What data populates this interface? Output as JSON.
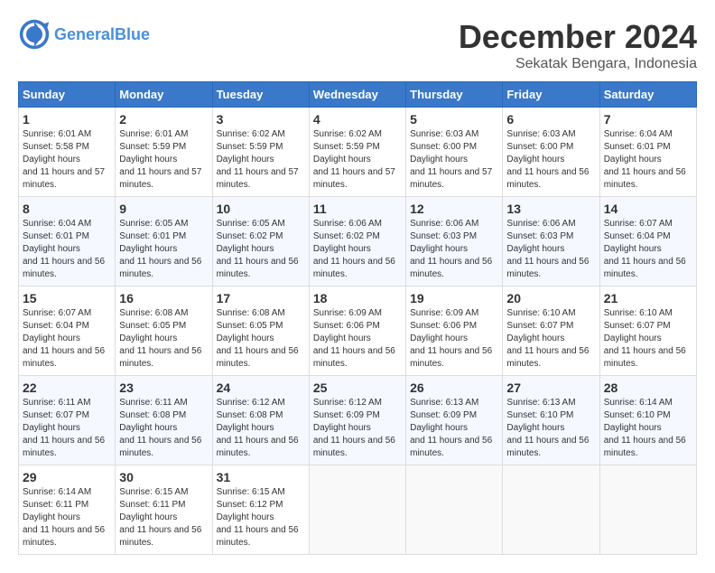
{
  "header": {
    "logo_text_general": "General",
    "logo_text_blue": "Blue",
    "month": "December 2024",
    "location": "Sekatak Bengara, Indonesia"
  },
  "weekdays": [
    "Sunday",
    "Monday",
    "Tuesday",
    "Wednesday",
    "Thursday",
    "Friday",
    "Saturday"
  ],
  "weeks": [
    [
      {
        "day": "1",
        "sunrise": "6:01 AM",
        "sunset": "5:58 PM",
        "daylight": "11 hours and 57 minutes."
      },
      {
        "day": "2",
        "sunrise": "6:01 AM",
        "sunset": "5:59 PM",
        "daylight": "11 hours and 57 minutes."
      },
      {
        "day": "3",
        "sunrise": "6:02 AM",
        "sunset": "5:59 PM",
        "daylight": "11 hours and 57 minutes."
      },
      {
        "day": "4",
        "sunrise": "6:02 AM",
        "sunset": "5:59 PM",
        "daylight": "11 hours and 57 minutes."
      },
      {
        "day": "5",
        "sunrise": "6:03 AM",
        "sunset": "6:00 PM",
        "daylight": "11 hours and 57 minutes."
      },
      {
        "day": "6",
        "sunrise": "6:03 AM",
        "sunset": "6:00 PM",
        "daylight": "11 hours and 56 minutes."
      },
      {
        "day": "7",
        "sunrise": "6:04 AM",
        "sunset": "6:01 PM",
        "daylight": "11 hours and 56 minutes."
      }
    ],
    [
      {
        "day": "8",
        "sunrise": "6:04 AM",
        "sunset": "6:01 PM",
        "daylight": "11 hours and 56 minutes."
      },
      {
        "day": "9",
        "sunrise": "6:05 AM",
        "sunset": "6:01 PM",
        "daylight": "11 hours and 56 minutes."
      },
      {
        "day": "10",
        "sunrise": "6:05 AM",
        "sunset": "6:02 PM",
        "daylight": "11 hours and 56 minutes."
      },
      {
        "day": "11",
        "sunrise": "6:06 AM",
        "sunset": "6:02 PM",
        "daylight": "11 hours and 56 minutes."
      },
      {
        "day": "12",
        "sunrise": "6:06 AM",
        "sunset": "6:03 PM",
        "daylight": "11 hours and 56 minutes."
      },
      {
        "day": "13",
        "sunrise": "6:06 AM",
        "sunset": "6:03 PM",
        "daylight": "11 hours and 56 minutes."
      },
      {
        "day": "14",
        "sunrise": "6:07 AM",
        "sunset": "6:04 PM",
        "daylight": "11 hours and 56 minutes."
      }
    ],
    [
      {
        "day": "15",
        "sunrise": "6:07 AM",
        "sunset": "6:04 PM",
        "daylight": "11 hours and 56 minutes."
      },
      {
        "day": "16",
        "sunrise": "6:08 AM",
        "sunset": "6:05 PM",
        "daylight": "11 hours and 56 minutes."
      },
      {
        "day": "17",
        "sunrise": "6:08 AM",
        "sunset": "6:05 PM",
        "daylight": "11 hours and 56 minutes."
      },
      {
        "day": "18",
        "sunrise": "6:09 AM",
        "sunset": "6:06 PM",
        "daylight": "11 hours and 56 minutes."
      },
      {
        "day": "19",
        "sunrise": "6:09 AM",
        "sunset": "6:06 PM",
        "daylight": "11 hours and 56 minutes."
      },
      {
        "day": "20",
        "sunrise": "6:10 AM",
        "sunset": "6:07 PM",
        "daylight": "11 hours and 56 minutes."
      },
      {
        "day": "21",
        "sunrise": "6:10 AM",
        "sunset": "6:07 PM",
        "daylight": "11 hours and 56 minutes."
      }
    ],
    [
      {
        "day": "22",
        "sunrise": "6:11 AM",
        "sunset": "6:07 PM",
        "daylight": "11 hours and 56 minutes."
      },
      {
        "day": "23",
        "sunrise": "6:11 AM",
        "sunset": "6:08 PM",
        "daylight": "11 hours and 56 minutes."
      },
      {
        "day": "24",
        "sunrise": "6:12 AM",
        "sunset": "6:08 PM",
        "daylight": "11 hours and 56 minutes."
      },
      {
        "day": "25",
        "sunrise": "6:12 AM",
        "sunset": "6:09 PM",
        "daylight": "11 hours and 56 minutes."
      },
      {
        "day": "26",
        "sunrise": "6:13 AM",
        "sunset": "6:09 PM",
        "daylight": "11 hours and 56 minutes."
      },
      {
        "day": "27",
        "sunrise": "6:13 AM",
        "sunset": "6:10 PM",
        "daylight": "11 hours and 56 minutes."
      },
      {
        "day": "28",
        "sunrise": "6:14 AM",
        "sunset": "6:10 PM",
        "daylight": "11 hours and 56 minutes."
      }
    ],
    [
      {
        "day": "29",
        "sunrise": "6:14 AM",
        "sunset": "6:11 PM",
        "daylight": "11 hours and 56 minutes."
      },
      {
        "day": "30",
        "sunrise": "6:15 AM",
        "sunset": "6:11 PM",
        "daylight": "11 hours and 56 minutes."
      },
      {
        "day": "31",
        "sunrise": "6:15 AM",
        "sunset": "6:12 PM",
        "daylight": "11 hours and 56 minutes."
      },
      null,
      null,
      null,
      null
    ]
  ]
}
